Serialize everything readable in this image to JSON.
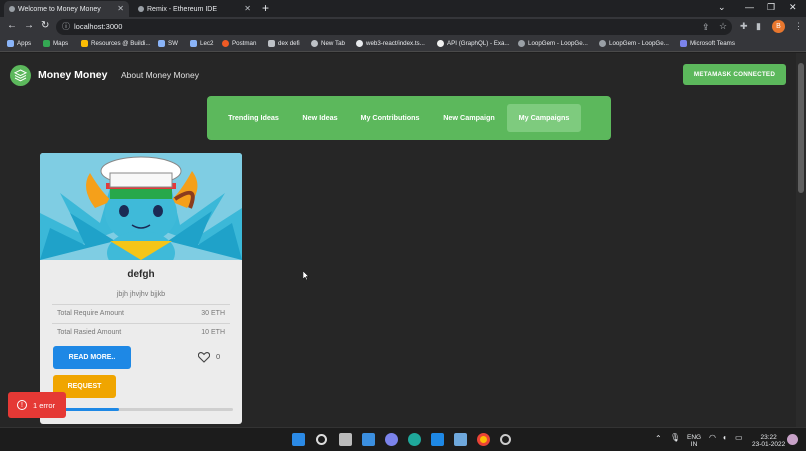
{
  "browser": {
    "tabs": [
      {
        "label": "Welcome to Money Money",
        "active": true
      },
      {
        "label": "Remix - Ethereum IDE",
        "active": false
      }
    ],
    "url": "localhost:3000",
    "profile_initial": "B",
    "bookmarks": [
      {
        "label": "Apps",
        "icon": "apps-grid-icon",
        "color": "#8ab4f8"
      },
      {
        "label": "Maps",
        "icon": "maps-icon",
        "color": "#34a853"
      },
      {
        "label": "Resources @ Buildi...",
        "icon": "bookmark-icon",
        "color": "#fbbc04"
      },
      {
        "label": "SW",
        "icon": "stack-icon",
        "color": "#8ab4f8"
      },
      {
        "label": "Lec2",
        "icon": "chat-icon",
        "color": "#8ab4f8"
      },
      {
        "label": "Postman",
        "icon": "postman-icon",
        "color": "#ef5b25"
      },
      {
        "label": "dex defi",
        "icon": "ethereum-icon",
        "color": "#bdc1c6"
      },
      {
        "label": "New Tab",
        "icon": "globe-icon",
        "color": "#bdc1c6"
      },
      {
        "label": "web3-react/index.ts...",
        "icon": "github-icon",
        "color": "#e8eaed"
      },
      {
        "label": "API (GraphQL) - Exa...",
        "icon": "api-icon",
        "color": "#f1f1f1"
      },
      {
        "label": "LoopGem - LoopGe...",
        "icon": "loopgem-icon",
        "color": "#9aa0a6"
      },
      {
        "label": "LoopGem - LoopGe...",
        "icon": "loopgem-icon",
        "color": "#9aa0a6"
      },
      {
        "label": "Microsoft Teams",
        "icon": "teams-icon",
        "color": "#7b83eb"
      }
    ]
  },
  "app": {
    "brand": "Money Money",
    "about_link": "About Money Money",
    "metamask_status": "METAMASK CONNECTED",
    "nav": [
      {
        "label": "Trending Ideas",
        "selected": false
      },
      {
        "label": "New Ideas",
        "selected": false
      },
      {
        "label": "My Contributions",
        "selected": false
      },
      {
        "label": "New Campaign",
        "selected": false
      },
      {
        "label": "My Campaigns",
        "selected": true
      }
    ],
    "campaign": {
      "title": "defgh",
      "description": "jbjh jhvjhv bjjkb",
      "rows": [
        {
          "label": "Total Require Amount",
          "value": "30 ETH"
        },
        {
          "label": "Total Rasied Amount",
          "value": "10 ETH"
        }
      ],
      "read_more": "READ MORE..",
      "likes": "0",
      "request": "REQUEST",
      "progress_fraction": 0.33
    },
    "error_toast": "1 error"
  },
  "taskbar": {
    "lang": "ENG",
    "region": "IN",
    "time": "23:22",
    "date": "23-01-2022"
  },
  "colors": {
    "accent_green": "#5cb85c",
    "button_blue": "#1e88e5",
    "button_amber": "#f0a500",
    "error_red": "#e53935"
  }
}
